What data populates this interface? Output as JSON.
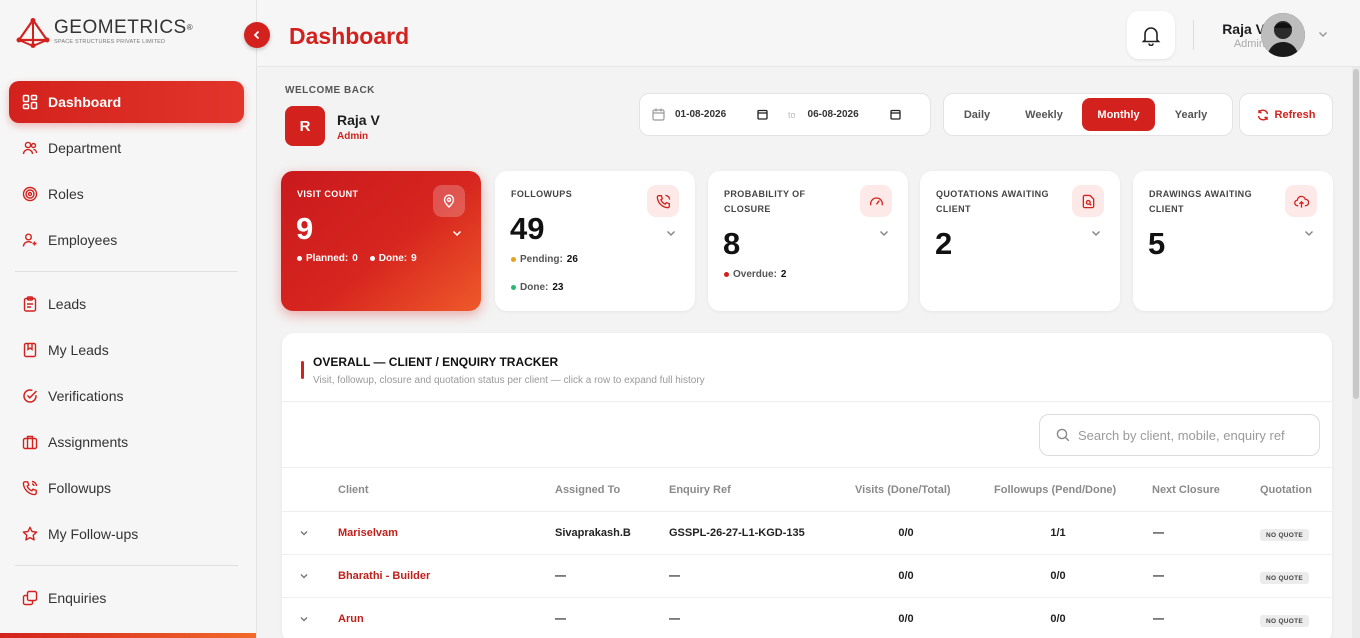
{
  "brand": {
    "name": "GEOMETRICS",
    "registered": "®",
    "tagline": "SPACE STRUCTURES PRIVATE LIMITED"
  },
  "sidebar": {
    "items": [
      {
        "label": "Dashboard",
        "icon": "grid-icon",
        "active": true
      },
      {
        "label": "Department",
        "icon": "users-icon"
      },
      {
        "label": "Roles",
        "icon": "target-icon"
      },
      {
        "label": "Employees",
        "icon": "user-plus-icon"
      },
      {
        "label": "Leads",
        "icon": "clipboard-icon"
      },
      {
        "label": "My Leads",
        "icon": "bookmark-book-icon"
      },
      {
        "label": "Verifications",
        "icon": "check-circle-icon"
      },
      {
        "label": "Assignments",
        "icon": "briefcase-icon"
      },
      {
        "label": "Followups",
        "icon": "phone-icon"
      },
      {
        "label": "My Follow-ups",
        "icon": "star-icon"
      },
      {
        "label": "Enquiries",
        "icon": "copy-icon"
      }
    ]
  },
  "header": {
    "title": "Dashboard",
    "user_name": "Raja V",
    "user_role": "Admin"
  },
  "welcome": {
    "label": "WELCOME BACK",
    "initial": "R",
    "name": "Raja V",
    "role": "Admin"
  },
  "filters": {
    "date_from": "01-08-2026",
    "date_to": "06-08-2026",
    "to_label": "to",
    "periods": [
      "Daily",
      "Weekly",
      "Monthly",
      "Yearly"
    ],
    "active_period": "Monthly",
    "refresh_label": "Refresh"
  },
  "stats": [
    {
      "label": "VISIT COUNT",
      "value": "9",
      "icon": "map-pin-icon",
      "meta": [
        {
          "label": "Planned:",
          "value": "0"
        },
        {
          "label": "Done:",
          "value": "9"
        }
      ]
    },
    {
      "label": "FOLLOWUPS",
      "value": "49",
      "icon": "phone-icon",
      "meta": [
        {
          "label": "Pending:",
          "value": "26",
          "color": "#e6a21a"
        },
        {
          "label": "Done:",
          "value": "23",
          "color": "#2bb673"
        }
      ]
    },
    {
      "label": "PROBABILITY OF CLOSURE",
      "value": "8",
      "icon": "gauge-icon",
      "meta": [
        {
          "label": "Overdue:",
          "value": "2",
          "color": "#d3221d"
        }
      ]
    },
    {
      "label": "QUOTATIONS AWAITING CLIENT",
      "value": "2",
      "icon": "file-search-icon",
      "meta": []
    },
    {
      "label": "DRAWINGS AWAITING CLIENT",
      "value": "5",
      "icon": "cloud-upload-icon",
      "meta": []
    }
  ],
  "tracker": {
    "title": "OVERALL — CLIENT / ENQUIRY TRACKER",
    "subtitle": "Visit, followup, closure and quotation status per client — click a row to expand full history",
    "search_placeholder": "Search by client, mobile, enquiry ref",
    "columns": [
      "Client",
      "Assigned To",
      "Enquiry Ref",
      "Visits (Done/Total)",
      "Followups (Pend/Done)",
      "Next Closure",
      "Quotation"
    ],
    "rows": [
      {
        "client": "Mariselvam",
        "assigned": "Sivaprakash.B",
        "enquiry": "GSSPL-26-27-L1-KGD-135",
        "visits": "0/0",
        "followups": "1/1",
        "closure": "—",
        "quotation": "NO QUOTE"
      },
      {
        "client": "Bharathi - Builder",
        "assigned": "—",
        "enquiry": "—",
        "visits": "0/0",
        "followups": "0/0",
        "closure": "—",
        "quotation": "NO QUOTE"
      },
      {
        "client": "Arun",
        "assigned": "—",
        "enquiry": "—",
        "visits": "0/0",
        "followups": "0/0",
        "closure": "—",
        "quotation": "NO QUOTE"
      }
    ]
  },
  "colors": {
    "accent": "#d3221d",
    "accent_gradient_end": "#ee5a2a",
    "pending": "#e6a21a",
    "done": "#2bb673"
  }
}
